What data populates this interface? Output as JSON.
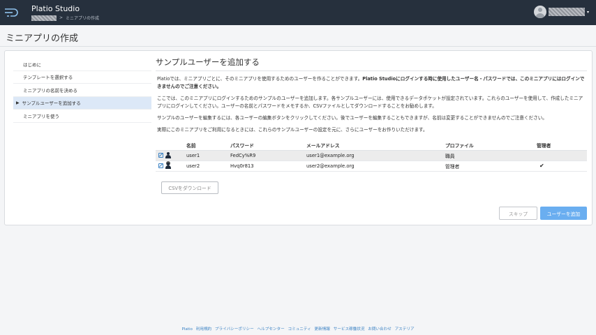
{
  "header": {
    "app_title": "Platio Studio",
    "breadcrumb_current": "ミニアプリの作成",
    "breadcrumb_sep": ">"
  },
  "page_title": "ミニアプリの作成",
  "sidebar": {
    "items": [
      {
        "label": "はじめに",
        "active": false
      },
      {
        "label": "テンプレートを選択する",
        "active": false
      },
      {
        "label": "ミニアプリの名前を決める",
        "active": false
      },
      {
        "label": "サンプルユーザーを追加する",
        "active": true
      },
      {
        "label": "ミニアプリを使う",
        "active": false
      }
    ]
  },
  "main": {
    "title": "サンプルユーザーを追加する",
    "para1_a": "Platioでは、ミニアプリごとに、そのミニアプリを使用するためのユーザーを作ることができます。",
    "para1_b": "Platio Studioにログインする時に使用したユーザー名・パスワードでは、このミニアプリにはログインできませんのでご注意ください。",
    "para2": "ここでは、このミニアプリにログインするためのサンプルのユーザーを追加します。各サンプルユーザーには、使用できるデータポケットが設定されています。これらのユーザーを使用して、作成したミニアプリにログインしてください。ユーザーの名前とパスワードをメモするか、CSVファイルとしてダウンロードすることをお勧めします。",
    "para3": "サンプルのユーザーを編集するには、各ユーザーの編集ボタンをクリックしてください。後でユーザーを編集することもできますが、名前は変更することができませんのでご注意ください。",
    "para4": "実際にこのミニアプリをご利用になるときには、これらのサンプルユーザーの設定を元に、さらにユーザーをお作りいただけます。",
    "table": {
      "headers": [
        "名前",
        "パスワード",
        "メールアドレス",
        "プロファイル",
        "管理者"
      ],
      "rows": [
        {
          "name": "user1",
          "password": "FedCy%R9",
          "email": "user1@example.org",
          "profile": "職員",
          "admin": ""
        },
        {
          "name": "user2",
          "password": "Hvq0r813",
          "email": "user2@example.org",
          "profile": "管理者",
          "admin": "✔"
        }
      ]
    },
    "csv_button": "CSVをダウンロード",
    "skip_button": "スキップ",
    "add_button": "ユーザーを追加"
  },
  "footer": {
    "links": [
      "Platio",
      "利用規約",
      "プライバシーポリシー",
      "ヘルプセンター",
      "コミュニティ",
      "更新情報",
      "サービス稼働状況",
      "お問い合わせ",
      "アステリア"
    ]
  },
  "colors": {
    "topbar": "#26303d",
    "accent": "#6aaef0",
    "link": "#3b82c4",
    "active_item": "#dce8f7"
  }
}
